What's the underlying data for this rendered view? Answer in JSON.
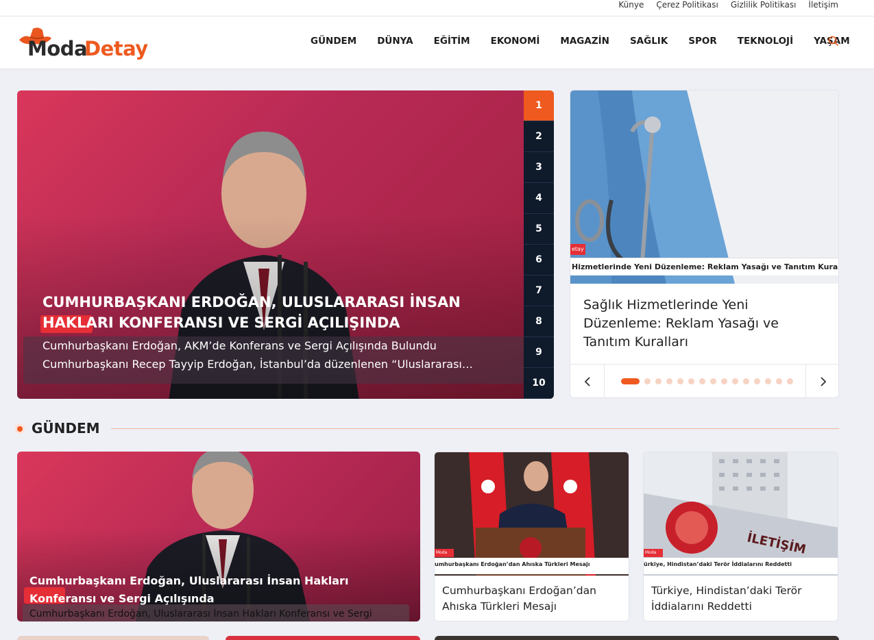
{
  "topbar": {
    "links": [
      "Künye",
      "Çerez Politikası",
      "Gizlilik Politikası",
      "İletişim"
    ]
  },
  "header": {
    "logo_part1": "Moda",
    "logo_part2": "Detay",
    "nav": [
      "GÜNDEM",
      "DÜNYA",
      "EĞİTİM",
      "EKONOMİ",
      "MAGAZİN",
      "SAĞLIK",
      "SPOR",
      "TEKNOLOJİ",
      "YAŞAM"
    ]
  },
  "hero": {
    "title": "CUMHURBAŞKANI ERDOĞAN, ULUSLARARASI İNSAN HAKLARI KONFERANSI VE SERGİ AÇILIŞINDA",
    "desc_line1": "Cumhurbaşkanı Erdoğan, AKM’de Konferans ve Sergi Açılışında Bulundu",
    "desc_line2": "Cumhurbaşkanı Recep Tayyip Erdoğan, İstanbul’da düzenlenen “Uluslararası…",
    "numbers": [
      "1",
      "2",
      "3",
      "4",
      "5",
      "6",
      "7",
      "8",
      "9",
      "10"
    ],
    "active_number": "1"
  },
  "side": {
    "badge": "etay",
    "strip": "Hizmetlerinde Yeni Düzenleme: Reklam Yasağı ve Tanıtım Kuralları",
    "title": "Sağlık Hizmetlerinde Yeni Düzenleme: Reklam Yasağı ve Tanıtım Kuralları",
    "prev": "‹",
    "next": "›",
    "dot_count": 15,
    "active_dot": 1
  },
  "section": {
    "title": "GÜNDEM"
  },
  "cards": {
    "big": {
      "title": "Cumhurbaşkanı Erdoğan, Uluslararası İnsan Hakları Konferansı ve Sergi Açılışında",
      "desc": "Cumhurbaşkanı Erdoğan, Uluslararası İnsan Hakları Konferansı ve Sergi"
    },
    "card1": {
      "badge": "Moda Detay",
      "strip": "umhurbaşkanı Erdoğan’dan Ahıska Türkleri Mesajı",
      "title": "Cumhurbaşkanı Erdoğan’dan Ahıska Türkleri Mesajı"
    },
    "card2": {
      "badge": "Moda Detay",
      "strip": "ürkiye, Hindistan’daki Terör İddialarını Reddetti",
      "title": "Türkiye, Hindistan’daki Terör İddialarını Reddetti"
    }
  },
  "colors": {
    "accent": "#ee5a1f",
    "dark_nav": "#0f1a2b",
    "badge_red": "#e52e36"
  },
  "icons": {
    "search": "search-icon",
    "logo_hat": "hat-icon"
  }
}
